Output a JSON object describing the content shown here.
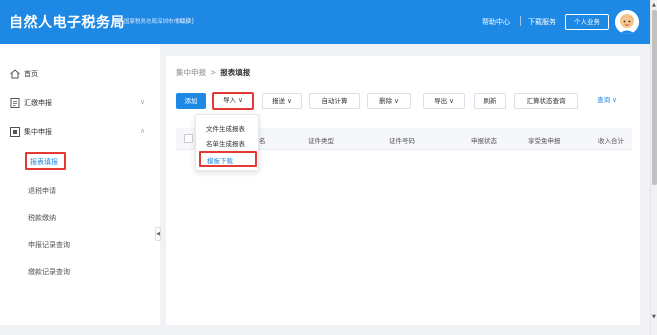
{
  "header": {
    "app_title": "自然人电子税务局",
    "org_name": "国家税务总局深圳市市山...",
    "switch_label": "[切换]",
    "help_label": "帮助中心",
    "download_label": "下载服务",
    "personal_label": "个人业务"
  },
  "sidebar": {
    "items": [
      {
        "label": "首页",
        "icon": "home-icon"
      },
      {
        "label": "汇缴申报",
        "icon": "document-icon"
      },
      {
        "label": "集中申报",
        "icon": "batch-icon"
      }
    ],
    "sub_items": [
      {
        "label": "报表填报"
      },
      {
        "label": "退税申请"
      },
      {
        "label": "税款缴纳"
      },
      {
        "label": "申报记录查询"
      },
      {
        "label": "缴款记录查询"
      }
    ]
  },
  "breadcrumb": {
    "parent": "集中申报",
    "separator": ">",
    "current": "报表填报"
  },
  "toolbar": {
    "add": "添加",
    "import": "导入",
    "submit": "报送",
    "auto_calc": "自动计算",
    "delete": "删除",
    "export": "导出",
    "refresh": "刷新",
    "status_query": "汇算状态查询",
    "query": "查询",
    "chevron": "∨"
  },
  "table": {
    "columns": [
      "名",
      "证件类型",
      "证件号码",
      "申报状态",
      "享受免申报",
      "收入合计"
    ]
  },
  "dropdown": {
    "items": [
      {
        "label": "文件生成报表"
      },
      {
        "label": "名单生成报表"
      },
      {
        "label": "模板下载"
      }
    ]
  },
  "colors": {
    "primary": "#1e88e5",
    "highlight": "#e53935"
  }
}
